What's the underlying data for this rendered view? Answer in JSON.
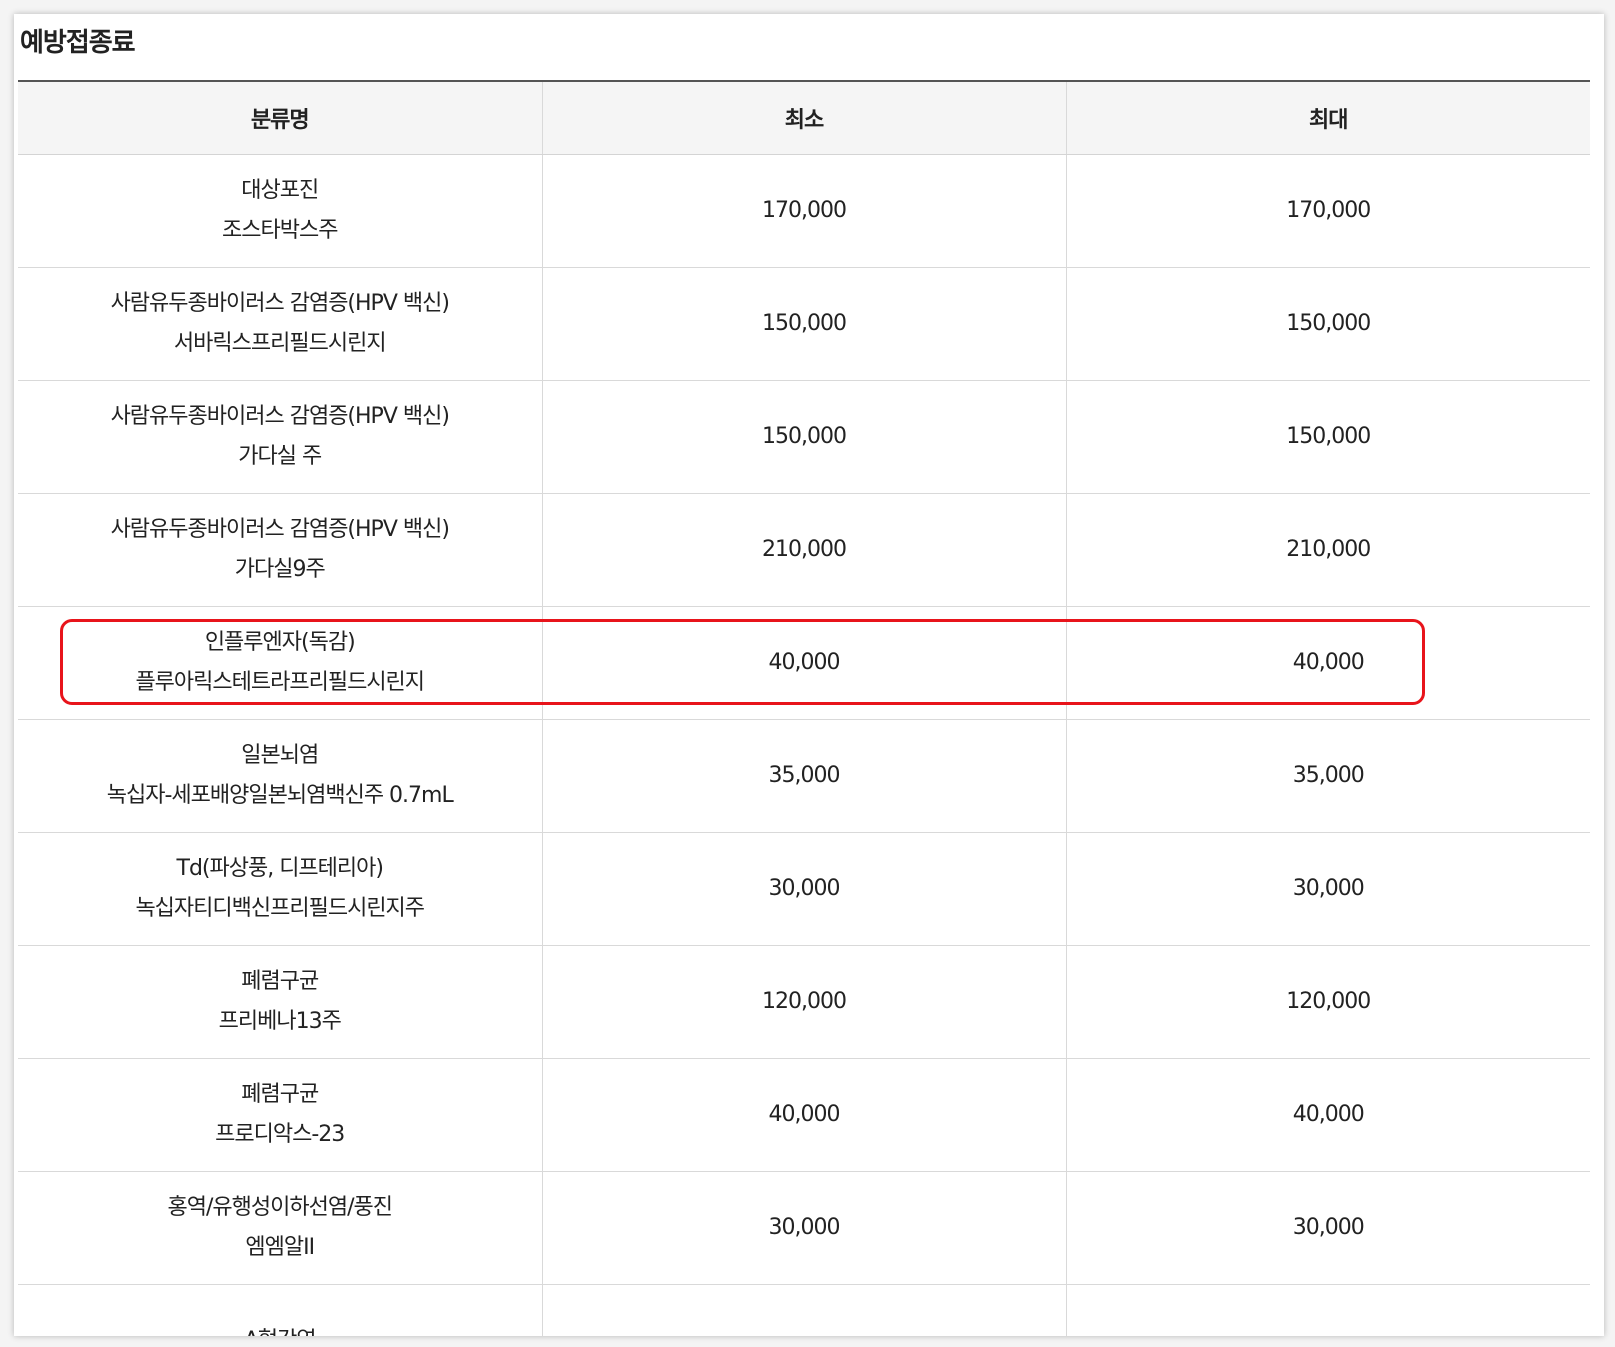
{
  "page": {
    "title": "예방접종료"
  },
  "table": {
    "headers": [
      "분류명",
      "최소",
      "최대"
    ],
    "rows": [
      {
        "category": "대상포진",
        "product": "조스타박스주",
        "min": "170,000",
        "max": "170,000"
      },
      {
        "category": "사람유두종바이러스 감염증(HPV 백신)",
        "product": "서바릭스프리필드시린지",
        "min": "150,000",
        "max": "150,000"
      },
      {
        "category": "사람유두종바이러스 감염증(HPV 백신)",
        "product": "가다실 주",
        "min": "150,000",
        "max": "150,000"
      },
      {
        "category": "사람유두종바이러스 감염증(HPV 백신)",
        "product": "가다실9주",
        "min": "210,000",
        "max": "210,000"
      },
      {
        "category": "인플루엔자(독감)",
        "product": "플루아릭스테트라프리필드시린지",
        "min": "40,000",
        "max": "40,000"
      },
      {
        "category": "일본뇌염",
        "product": "녹십자-세포배양일본뇌염백신주 0.7mL",
        "min": "35,000",
        "max": "35,000"
      },
      {
        "category": "Td(파상풍, 디프테리아)",
        "product": "녹십자티디백신프리필드시린지주",
        "min": "30,000",
        "max": "30,000"
      },
      {
        "category": "폐렴구균",
        "product": "프리베나13주",
        "min": "120,000",
        "max": "120,000"
      },
      {
        "category": "폐렴구균",
        "product": "프로디악스-23",
        "min": "40,000",
        "max": "40,000"
      },
      {
        "category": "홍역/유행성이하선염/풍진",
        "product": "엠엠알II",
        "min": "30,000",
        "max": "30,000"
      },
      {
        "category": "A형간염",
        "product": "",
        "min": "",
        "max": ""
      }
    ]
  },
  "colors": {
    "highlight": "#e8141b",
    "header_bg": "#f5f5f5"
  }
}
